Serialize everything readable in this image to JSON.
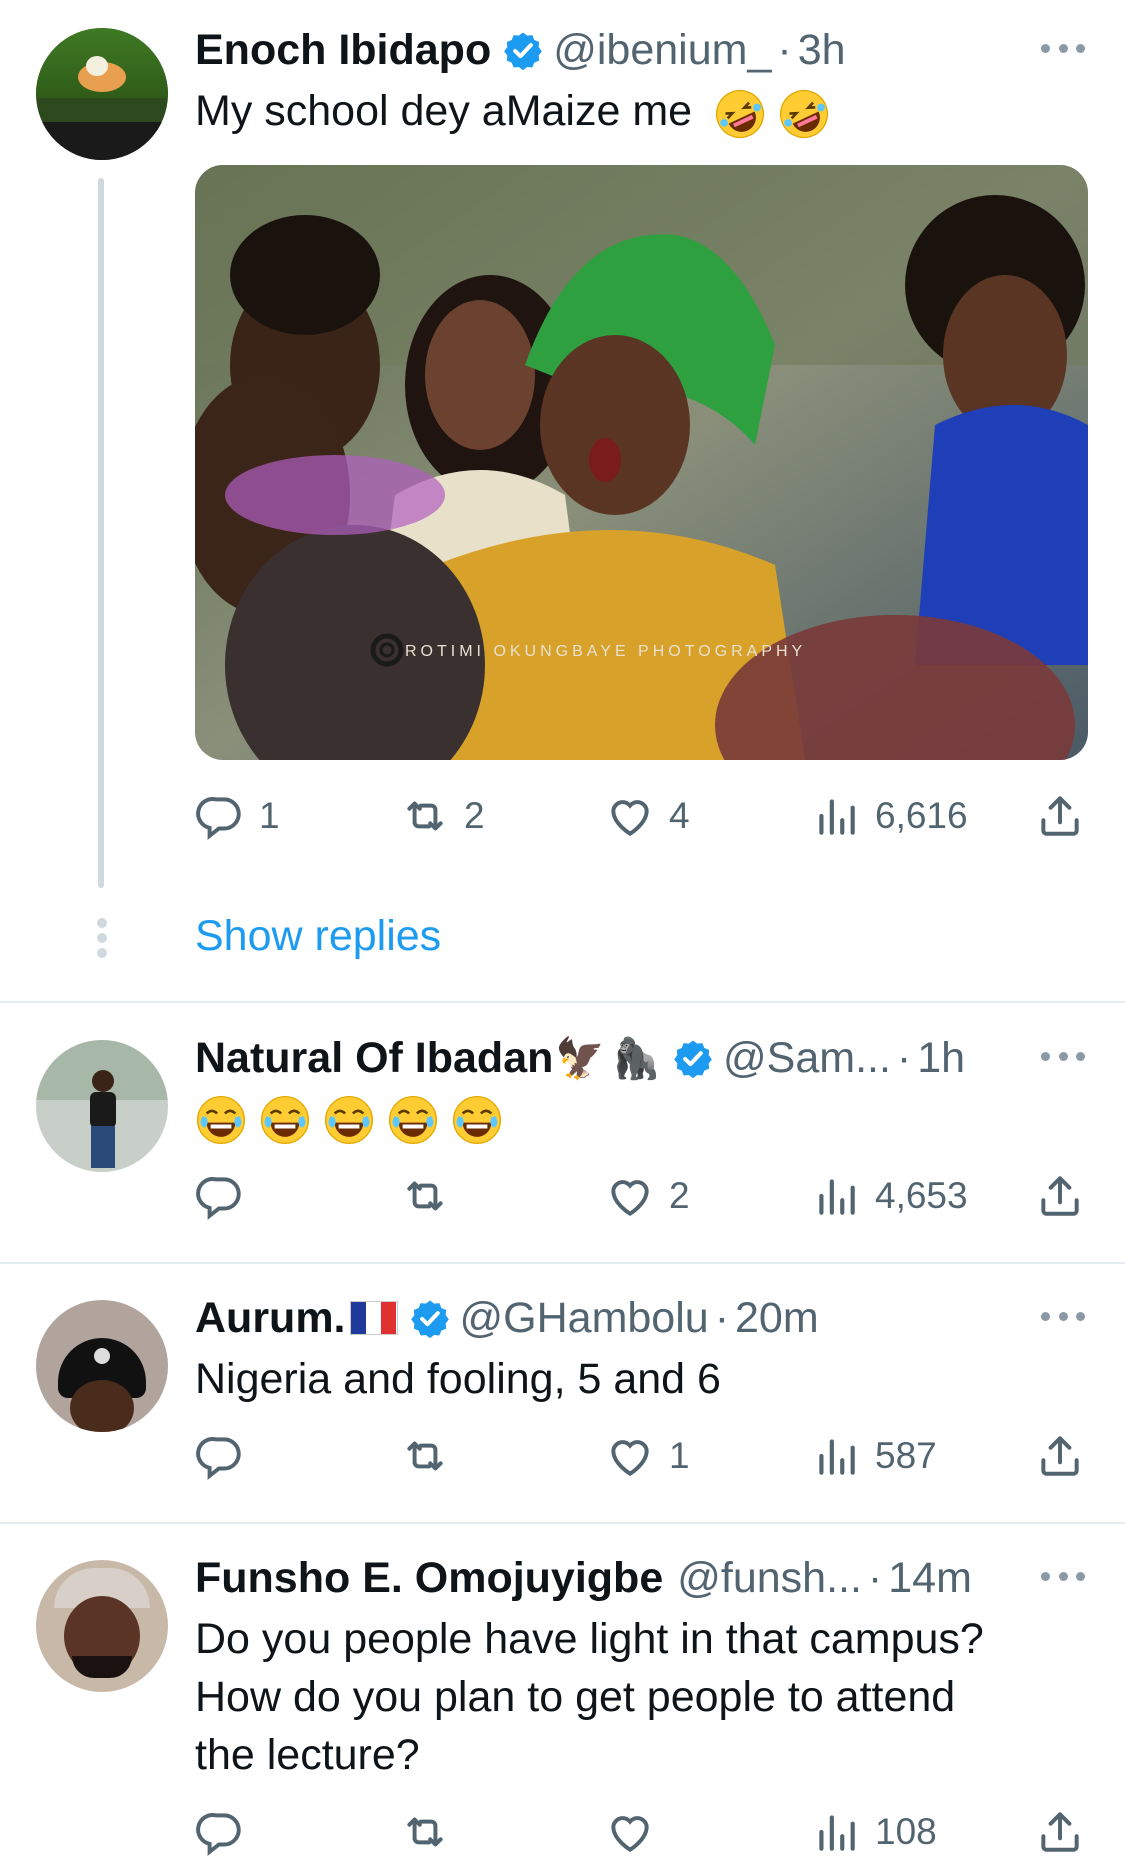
{
  "colors": {
    "link": "#1d9bf0",
    "verified": "#1d9bf0",
    "muted": "#536471",
    "divider": "#e6ecf0"
  },
  "tweets": [
    {
      "author": "Enoch Ibidapo",
      "verified": true,
      "handle": "@ibenium_",
      "time": "3h",
      "text": "My school dey aMaize me",
      "emojis": [
        "rolling-on-floor-laughing",
        "rolling-on-floor-laughing"
      ],
      "media": {
        "watermark": "ROTIMI OKUNGBAYE PHOTOGRAPHY"
      },
      "stats": {
        "replies": "1",
        "retweets": "2",
        "likes": "4",
        "views": "6,616"
      }
    },
    {
      "author": "Natural Of Ibadan",
      "name_emojis": [
        "eagle",
        "gorilla"
      ],
      "verified": true,
      "handle": "@Sam...",
      "time": "1h",
      "emojis": [
        "face-with-tears-of-joy",
        "face-with-tears-of-joy",
        "face-with-tears-of-joy",
        "face-with-tears-of-joy",
        "face-with-tears-of-joy"
      ],
      "stats": {
        "replies": "",
        "retweets": "",
        "likes": "2",
        "views": "4,653"
      }
    },
    {
      "author": "Aurum.",
      "name_emojis": [
        "flag-france"
      ],
      "verified": true,
      "handle": "@GHambolu",
      "time": "20m",
      "text": "Nigeria and fooling, 5 and 6",
      "stats": {
        "replies": "",
        "retweets": "",
        "likes": "1",
        "views": "587"
      }
    },
    {
      "author": "Funsho E. Omojuyigbe",
      "verified": false,
      "handle": "@funsh...",
      "time": "14m",
      "text_lines": [
        "Do you people have light in that campus?",
        "How do you plan to get people to attend",
        "the lecture?"
      ],
      "stats": {
        "replies": "",
        "retweets": "",
        "likes": "",
        "views": "108"
      }
    }
  ],
  "show_replies_label": "Show replies",
  "separator": "·"
}
